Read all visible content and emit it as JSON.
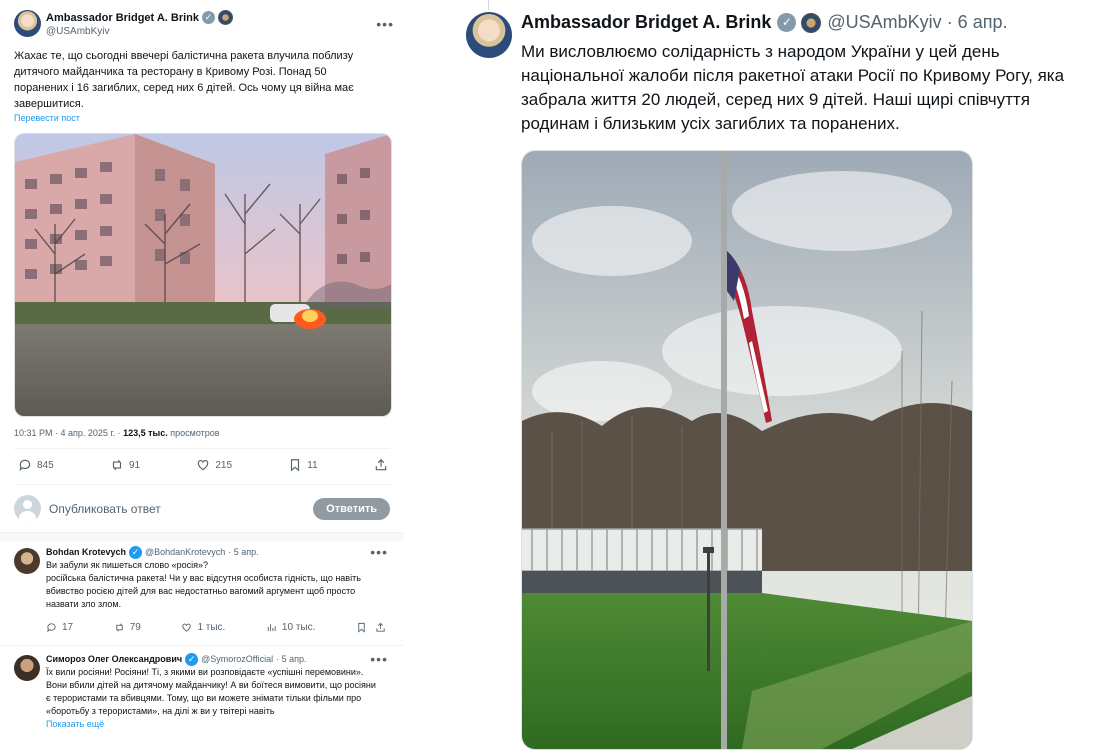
{
  "left": {
    "author": {
      "name": "Ambassador Bridget A. Brink",
      "handle": "@USAmbKyiv"
    },
    "text": "Жахає те, що сьогодні ввечері балістична ракета влучила поблизу дитячого майданчика та ресторану в Кривому Розі. Понад 50 поранених і 16 загиблих, серед них 6 дітей. Ось чому ця війна має завершитися.",
    "translate": "Перевести пост",
    "meta": {
      "time": "10:31 PM · 4 апр. 2025 г. · ",
      "views": "123,5 тыс.",
      "views_label": " просмотров"
    },
    "actions": {
      "replies": "845",
      "reposts": "91",
      "likes": "215",
      "bookmarks": "11"
    },
    "compose": {
      "placeholder": "Опубликовать ответ",
      "button": "Ответить"
    },
    "replies": [
      {
        "name": "Bohdan Krotevych",
        "handle": "@BohdanKrotevych",
        "date": "· 5 апр.",
        "text1": "Ви забули як пишеться слово «росія»?",
        "text2": "російська балістична ракета! Чи у вас відсутня особиста  гідність, що навіть вбивство  росією дітей для вас недостатньо вагомий аргумент щоб  просто назвати зло злом.",
        "stats": {
          "replies": "17",
          "reposts": "79",
          "likes": "1 тыс.",
          "views": "10 тыс."
        }
      },
      {
        "name": "Симороз Олег Олександрович",
        "handle": "@SymorozOfficial",
        "date": "· 5 апр.",
        "text": "Їх вили росіяни! Росіяни! Ті, з якими ви розповідаєте «успішні перемовини». Вони вбили дітей на дитячому майданчику! А ви боїтеся вимовити, що росіяни є терористами та вбивцями. Тому, що ви можете знімати тільки фільми про «боротьбу з терористами», на ділі ж ви у твітері навіть",
        "show_more": "Показать ещё"
      }
    ]
  },
  "right": {
    "author": {
      "name": "Ambassador Bridget A. Brink",
      "handle": "@USAmbKyiv",
      "date": "· 6 апр."
    },
    "text": "Ми висловлюємо солідарність з народом України у цей день національної жалоби після ракетної атаки Росії по Кривому Рогу, яка забрала життя 20 людей, серед них 9 дітей. Наші щирі співчуття родинам і близьким усіх загиблих та поранених."
  }
}
